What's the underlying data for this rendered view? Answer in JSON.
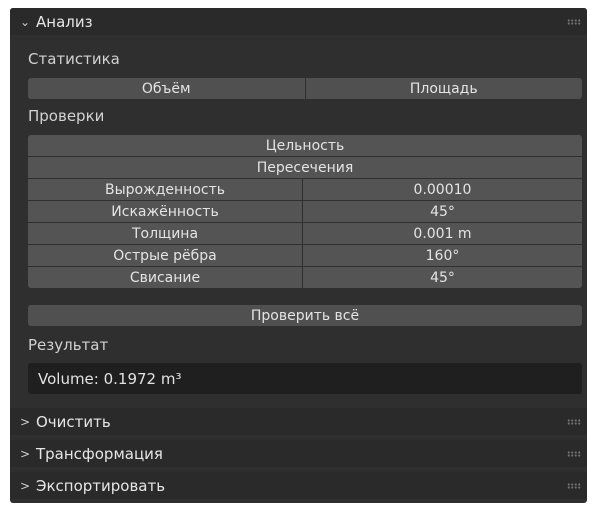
{
  "analysis_panel": {
    "title": "Анализ",
    "chevron": "chevron-down-icon",
    "statistics": {
      "label": "Статистика",
      "buttons": [
        "Объём",
        "Площадь"
      ]
    },
    "checks": {
      "label": "Проверки",
      "full_buttons": [
        "Цельность",
        "Пересечения"
      ],
      "params": [
        {
          "label": "Вырожденность",
          "value": "0.00010"
        },
        {
          "label": "Искажённость",
          "value": "45°"
        },
        {
          "label": "Толщина",
          "value": "0.001 m"
        },
        {
          "label": "Острые рёбра",
          "value": "160°"
        },
        {
          "label": "Свисание",
          "value": "45°"
        }
      ],
      "check_all": "Проверить всё"
    },
    "result": {
      "label": "Результат",
      "text": "Volume: 0.1972 m³"
    }
  },
  "collapsed_panels": [
    {
      "title": "Очистить",
      "chevron": "chevron-right-icon"
    },
    {
      "title": "Трансформация",
      "chevron": "chevron-right-icon"
    },
    {
      "title": "Экспортировать",
      "chevron": "chevron-right-icon"
    }
  ],
  "colors": {
    "panel_bg": "#2f2f2f",
    "header_bg": "#2a2a2a",
    "button_bg": "#505050",
    "field_bg": "#545454",
    "result_bg": "#1f1f1f",
    "text": "#e4e4e4"
  }
}
